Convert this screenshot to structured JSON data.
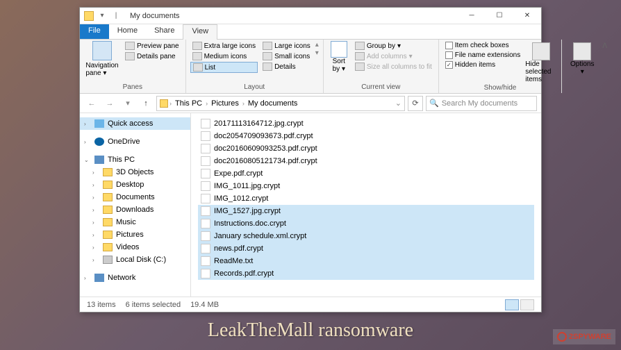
{
  "titlebar": {
    "title": "My documents"
  },
  "tabs": {
    "file": "File",
    "home": "Home",
    "share": "Share",
    "view": "View"
  },
  "ribbon": {
    "panes": {
      "navigation_pane": "Navigation\npane",
      "preview_pane": "Preview pane",
      "details_pane": "Details pane",
      "label": "Panes"
    },
    "layout": {
      "extra_large": "Extra large icons",
      "large": "Large icons",
      "medium": "Medium icons",
      "small": "Small icons",
      "list": "List",
      "details": "Details",
      "label": "Layout"
    },
    "current_view": {
      "sort_by": "Sort\nby",
      "group_by": "Group by",
      "add_columns": "Add columns",
      "size_columns": "Size all columns to fit",
      "label": "Current view"
    },
    "show_hide": {
      "item_check": "Item check boxes",
      "file_ext": "File name extensions",
      "hidden": "Hidden items",
      "hide_selected": "Hide selected\nitems",
      "label": "Show/hide"
    },
    "options": "Options"
  },
  "breadcrumb": {
    "pc": "This PC",
    "pictures": "Pictures",
    "folder": "My documents"
  },
  "search": {
    "placeholder": "Search My documents"
  },
  "sidebar": {
    "quick_access": "Quick access",
    "onedrive": "OneDrive",
    "this_pc": "This PC",
    "items": [
      "3D Objects",
      "Desktop",
      "Documents",
      "Downloads",
      "Music",
      "Pictures",
      "Videos",
      "Local Disk (C:)"
    ],
    "network": "Network"
  },
  "files": [
    {
      "name": "20171113164712.jpg.crypt",
      "selected": false
    },
    {
      "name": "doc2054709093673.pdf.crypt",
      "selected": false
    },
    {
      "name": "doc20160609093253.pdf.crypt",
      "selected": false
    },
    {
      "name": "doc20160805121734.pdf.crypt",
      "selected": false
    },
    {
      "name": "Expe.pdf.crypt",
      "selected": false
    },
    {
      "name": "IMG_1011.jpg.crypt",
      "selected": false
    },
    {
      "name": "IMG_1012.crypt",
      "selected": false
    },
    {
      "name": "IMG_1527.jpg.crypt",
      "selected": true
    },
    {
      "name": "Instructions.doc.crypt",
      "selected": true
    },
    {
      "name": "January schedule.xml.crypt",
      "selected": true
    },
    {
      "name": "news.pdf.crypt",
      "selected": true
    },
    {
      "name": "ReadMe.txt",
      "selected": true
    },
    {
      "name": "Records.pdf.crypt",
      "selected": true
    }
  ],
  "statusbar": {
    "count": "13 items",
    "selected": "6 items selected",
    "size": "19.4 MB"
  },
  "watermark": {
    "text": "LeakTheMall ransomware",
    "logo": "2SPYWARE"
  }
}
